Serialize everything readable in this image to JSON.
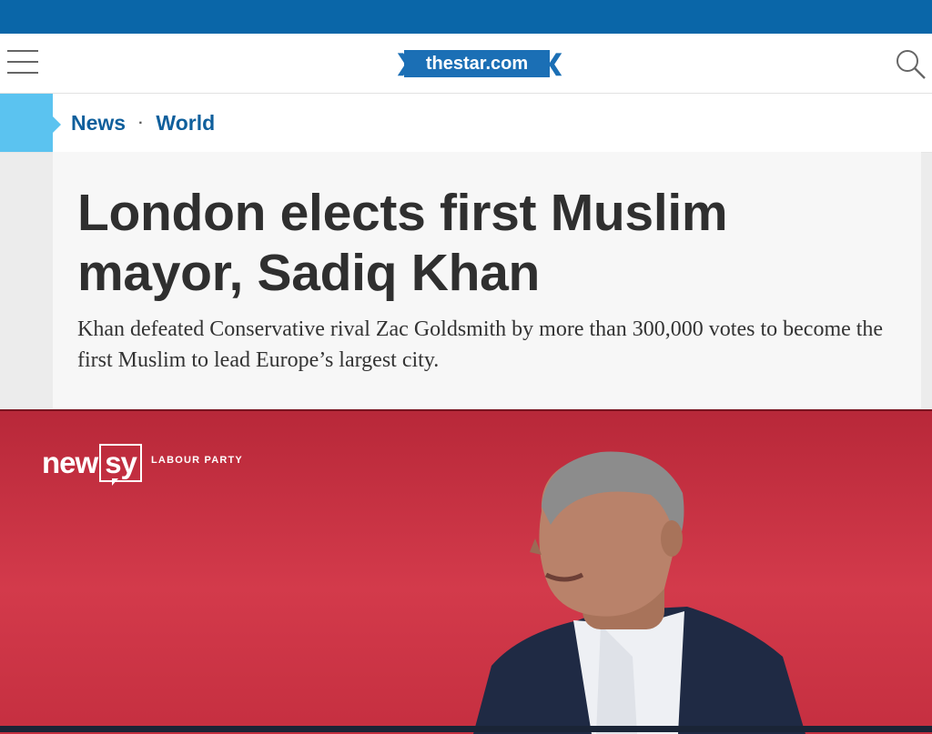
{
  "site": {
    "logo_text": "thestar.com"
  },
  "breadcrumb": {
    "items": [
      "News",
      "World"
    ],
    "separator": "·"
  },
  "article": {
    "headline": "London elects first Muslim mayor, Sadiq Khan",
    "dek": "Khan defeated Conservative rival Zac Goldsmith by more than 300,000 votes to become the first Muslim to lead Europe’s largest city."
  },
  "video": {
    "brand": "newsy",
    "brand_part1": "new",
    "brand_part2": "sy",
    "caption": "LABOUR PARTY"
  },
  "colors": {
    "top_bar": "#0a66a8",
    "brand_blue": "#1b6fb5",
    "link_blue": "#0f5f9c",
    "accent_cyan": "#5bc3f0",
    "video_red": "#cf3445"
  },
  "icons": {
    "menu": "hamburger-icon",
    "search": "search-icon"
  }
}
